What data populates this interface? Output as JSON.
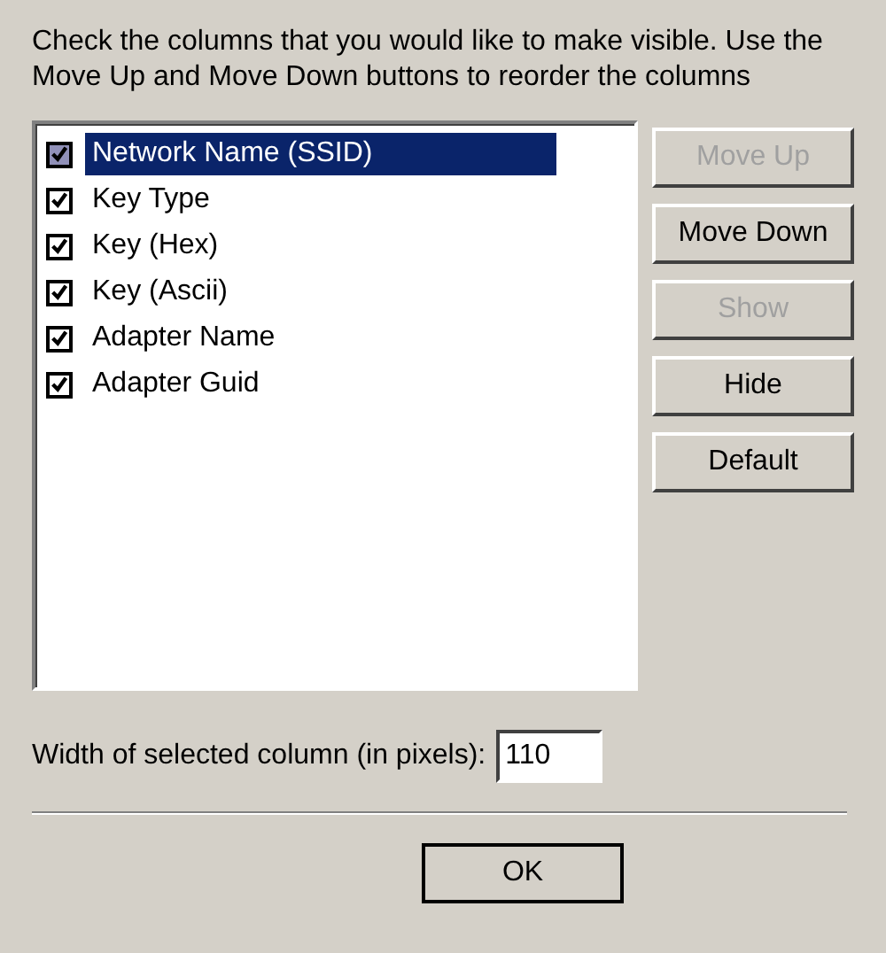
{
  "instructions": "Check the columns that you would like to make visible. Use the Move Up and Move Down buttons to reorder the columns",
  "columns": [
    {
      "label": "Network Name (SSID)",
      "checked": true,
      "selected": true
    },
    {
      "label": "Key Type",
      "checked": true,
      "selected": false
    },
    {
      "label": "Key (Hex)",
      "checked": true,
      "selected": false
    },
    {
      "label": "Key (Ascii)",
      "checked": true,
      "selected": false
    },
    {
      "label": "Adapter Name",
      "checked": true,
      "selected": false
    },
    {
      "label": "Adapter Guid",
      "checked": true,
      "selected": false
    }
  ],
  "side_buttons": [
    {
      "label": "Move Up",
      "disabled": true
    },
    {
      "label": "Move Down",
      "disabled": false
    },
    {
      "label": "Show",
      "disabled": true
    },
    {
      "label": "Hide",
      "disabled": false
    },
    {
      "label": "Default",
      "disabled": false
    }
  ],
  "width_field": {
    "label": "Width of selected column (in pixels):",
    "value": "110"
  },
  "ok_button": {
    "label": "OK"
  }
}
